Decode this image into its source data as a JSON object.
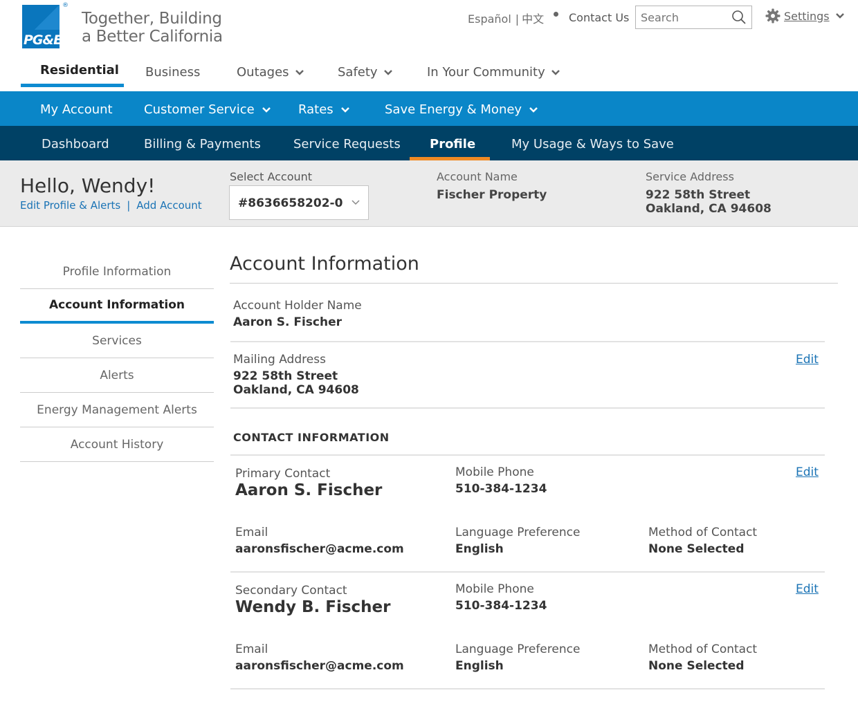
{
  "header": {
    "logo_text": "PG&E",
    "tagline_line1": "Together, Building",
    "tagline_line2": "a Better California",
    "lang_es": "Español",
    "lang_zh": "中文",
    "contact": "Contact Us",
    "search_placeholder": "Search",
    "settings": "Settings"
  },
  "nav_primary": [
    "Residential",
    "Business",
    "Outages",
    "Safety",
    "In Your Community"
  ],
  "nav_secondary": [
    "My Account",
    "Customer Service",
    "Rates",
    "Save Energy & Money"
  ],
  "nav_tertiary": [
    "Dashboard",
    "Billing & Payments",
    "Service Requests",
    "Profile",
    "My Usage & Ways to Save"
  ],
  "account_bar": {
    "greeting": "Hello, Wendy!",
    "edit_profile": "Edit Profile & Alerts",
    "add_account": "Add Account",
    "select_label": "Select Account",
    "selected_account": "#8636658202-0",
    "account_name_label": "Account Name",
    "account_name": "Fischer Property",
    "service_address_label": "Service Address",
    "service_address_line1": "922 58th Street",
    "service_address_line2": "Oakland, CA 94608"
  },
  "sidebar": [
    "Profile Information",
    "Account Information",
    "Services",
    "Alerts",
    "Energy Management Alerts",
    "Account History"
  ],
  "main": {
    "title": "Account Information",
    "holder_label": "Account Holder Name",
    "holder_name": "Aaron S. Fischer",
    "mailing_label": "Mailing Address",
    "mailing_line1": "922 58th Street",
    "mailing_line2": "Oakland, CA 94608",
    "edit": "Edit",
    "contact_heading": "CONTACT INFORMATION",
    "primary": {
      "label": "Primary Contact",
      "name": "Aaron S. Fischer",
      "mobile_label": "Mobile Phone",
      "mobile": "510-384-1234",
      "email_label": "Email",
      "email": "aaronsfischer@acme.com",
      "lang_label": "Language Preference",
      "lang": "English",
      "method_label": "Method of Contact",
      "method": "None Selected"
    },
    "secondary": {
      "label": "Secondary Contact",
      "name": "Wendy B. Fischer",
      "mobile_label": "Mobile Phone",
      "mobile": "510-384-1234",
      "email_label": "Email",
      "email": "aaronsfischer@acme.com",
      "lang_label": "Language Preference",
      "lang": "English",
      "method_label": "Method of Contact",
      "method": "None Selected"
    }
  },
  "colors": {
    "brand_blue": "#0a86c8",
    "dark_navy": "#004165",
    "accent_orange": "#f08a24",
    "link_blue": "#1a73b5"
  }
}
